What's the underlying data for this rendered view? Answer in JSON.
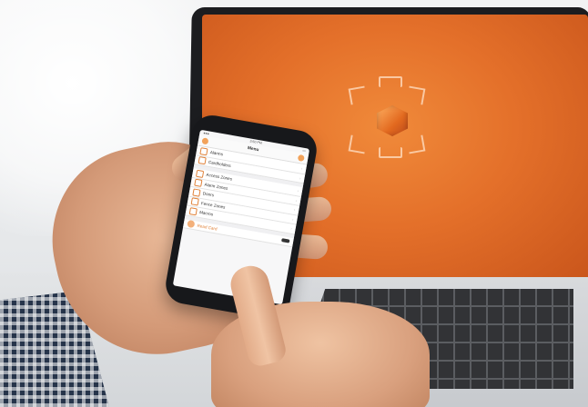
{
  "phone_app": {
    "status_time": "3:50 PM",
    "nav_title": "Menu",
    "menu_items": [
      {
        "label": "Alarms",
        "icon": "user-icon"
      },
      {
        "label": "Cardholders",
        "icon": "cardholders-icon"
      },
      {
        "label": "Access Zones",
        "icon": "access-zones-icon"
      },
      {
        "label": "Alarm Zones",
        "icon": "alarm-zones-icon"
      },
      {
        "label": "Doors",
        "icon": "door-icon"
      },
      {
        "label": "Fence Zones",
        "icon": "fence-icon"
      },
      {
        "label": "Macros",
        "icon": "macros-icon"
      },
      {
        "label": "Read Card",
        "icon": "read-card-icon"
      }
    ]
  },
  "colors": {
    "laptop_screen": "#e4702a",
    "accent": "#e0823a"
  },
  "laptop_logo": "cube-in-brackets-logo"
}
